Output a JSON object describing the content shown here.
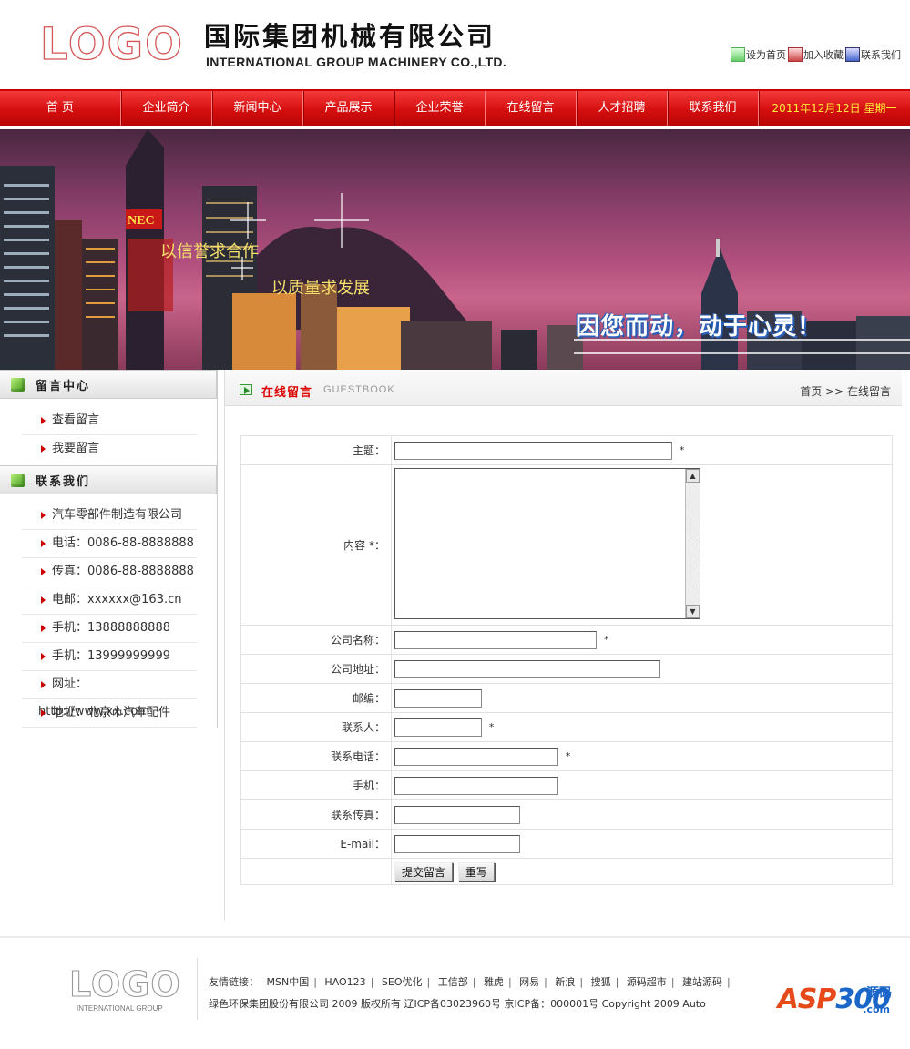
{
  "header": {
    "logo_text": "LOGO",
    "company_cn": "国际集团机械有限公司",
    "company_en": "INTERNATIONAL GROUP MACHINERY CO.,LTD.",
    "top_links": [
      {
        "label": "设为首页",
        "icon": "home-icon"
      },
      {
        "label": "加入收藏",
        "icon": "favorite-icon"
      },
      {
        "label": "联系我们",
        "icon": "contact-icon"
      }
    ]
  },
  "nav": {
    "items": [
      "首 页",
      "企业简介",
      "新闻中心",
      "产品展示",
      "企业荣誉",
      "在线留言",
      "人才招聘",
      "联系我们"
    ],
    "date": "2011年12月12日 星期一"
  },
  "banner": {
    "slogan1": "以信誉求合作",
    "slogan2": "以质量求发展",
    "slogan3": "因您而动，动于心灵！",
    "sign_text": "NEC"
  },
  "sidebar": {
    "section1_title": "留言中心",
    "section1_items": [
      "查看留言",
      "我要留言"
    ],
    "section2_title": "联系我们",
    "section2_items": [
      "汽车零部件制造有限公司",
      "电话：0086-88-8888888",
      "传真：0086-88-8888888",
      "电邮：xxxxxx@163.cn",
      "手机：13888888888",
      "手机：13999999999",
      "网址：http://www.xx.com",
      "地址：北京市汽车配件"
    ]
  },
  "main": {
    "title": "在线留言",
    "title_en": "GUESTBOOK",
    "breadcrumb": "首页 >> 在线留言",
    "form": {
      "subject_label": "主题：",
      "content_label": "内容 *：",
      "company_label": "公司名称：",
      "address_label": "公司地址：",
      "zip_label": "邮编：",
      "contact_label": "联系人：",
      "phone_label": "联系电话：",
      "mobile_label": "手机：",
      "fax_label": "联系传真：",
      "email_label": "E-mail：",
      "required_mark": "*",
      "submit_label": "提交留言",
      "reset_label": "重写"
    }
  },
  "footer": {
    "logo_text": "LOGO",
    "logo_sub": "INTERNATIONAL GROUP",
    "links_label": "友情链接：",
    "links": [
      "MSN中国",
      "HAO123",
      "SEO优化",
      "工信部",
      "雅虎",
      "网易",
      "新浪",
      "搜狐",
      "源码超市",
      "建站源码"
    ],
    "copyright": "绿色环保集团股份有限公司 2009 版权所有 辽ICP备03023960号 京ICP备：000001号 Copyright 2009 Auto",
    "watermark_asp": "ASP",
    "watermark_num": "300",
    "watermark_yuan": "源码",
    "watermark_com": ".com"
  }
}
